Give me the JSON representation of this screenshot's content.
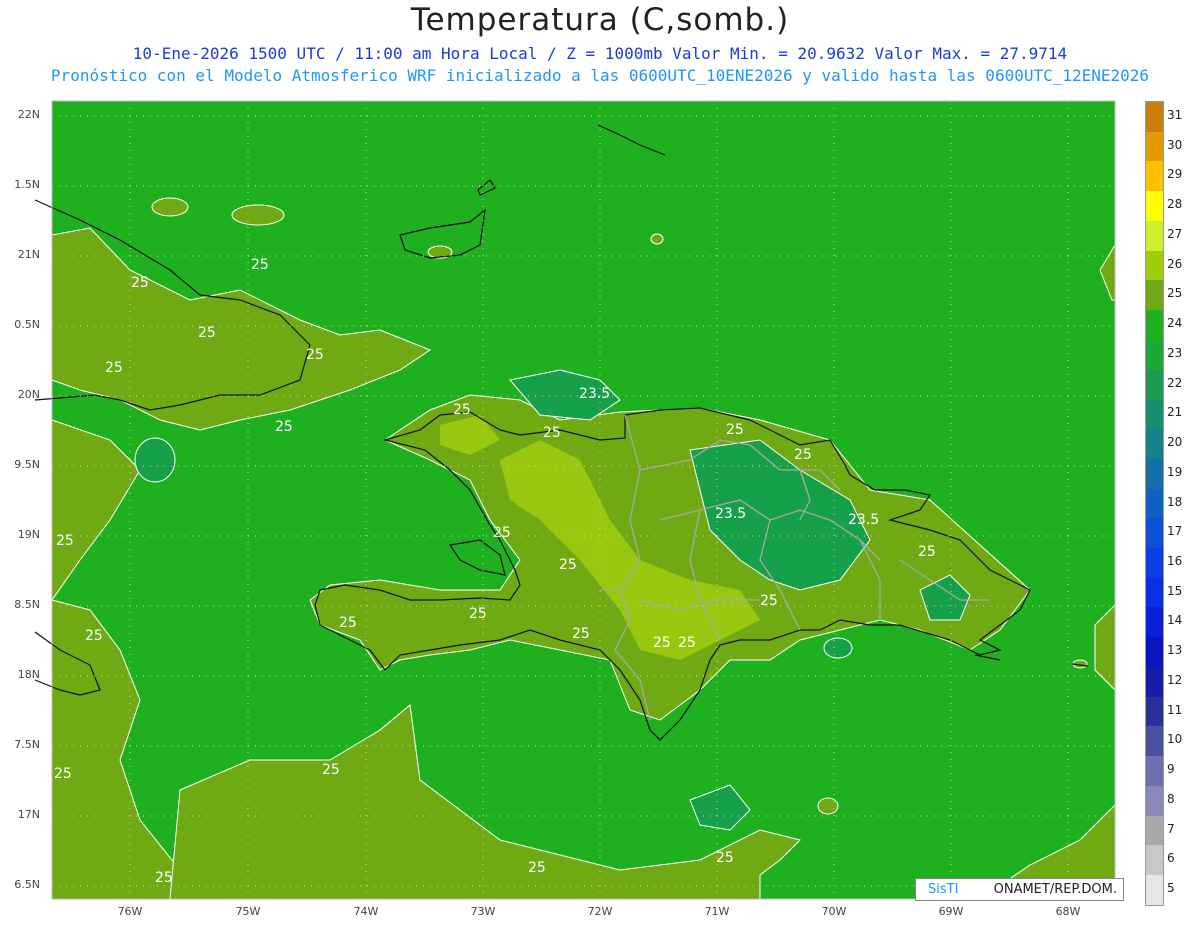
{
  "header": {
    "title": "Temperatura (C,somb.)",
    "line1": "10-Ene-2026 1500 UTC / 11:00 am Hora Local / Z = 1000mb  Valor Min. = 20.9632  Valor Max. = 27.9714",
    "line2": "Pronóstico con el Modelo Atmosferico WRF inicializado a las 0600UTC_10ENE2026 y valido hasta las  0600UTC_12ENE2026"
  },
  "map": {
    "lat_labels": [
      "22N",
      "1.5N",
      "21N",
      "0.5N",
      "20N",
      "9.5N",
      "19N",
      "8.5N",
      "18N",
      "7.5N",
      "17N",
      "6.5N"
    ],
    "lon_labels": [
      "76W",
      "75W",
      "74W",
      "73W",
      "72W",
      "71W",
      "70W",
      "69W",
      "68W"
    ],
    "contour_labels": [
      "25",
      "25",
      "25",
      "25",
      "25",
      "25",
      "25",
      "25",
      "25",
      "25",
      "25",
      "25",
      "25",
      "25",
      "25",
      "25",
      "25",
      "25",
      "25",
      "25",
      "23.5",
      "23.5",
      "23.5"
    ],
    "colors": {
      "c24": "#1fb01f",
      "c25": "#6faa14",
      "c26": "#99c70f",
      "c23": "#16a04a",
      "c22": "#2ea06a",
      "c27": "#b6dc00"
    }
  },
  "legend": {
    "levels": [
      "31",
      "30",
      "29",
      "28",
      "27",
      "26",
      "25",
      "24",
      "23",
      "22",
      "21",
      "20",
      "19",
      "18",
      "17",
      "16",
      "15",
      "14",
      "13",
      "12",
      "11",
      "10",
      "9",
      "8",
      "7",
      "6",
      "5"
    ],
    "colors": [
      "#c87e08",
      "#e69a00",
      "#ffc000",
      "#ffff00",
      "#cdef2c",
      "#9ecd0a",
      "#6faa14",
      "#1fb01f",
      "#1ea836",
      "#1c9c52",
      "#1a8f70",
      "#17808c",
      "#1470a8",
      "#1160c4",
      "#0e4fd8",
      "#0b3fe6",
      "#0a2fe6",
      "#0a20d8",
      "#0a14c0",
      "#141ca8",
      "#2a3098",
      "#4a50a0",
      "#6a70b0",
      "#8a88b8",
      "#a8a8a8",
      "#c8c8c8",
      "#e6e6e6"
    ]
  },
  "credit": {
    "brand": "SisTI",
    "org": "ONAMET/REP.DOM."
  }
}
